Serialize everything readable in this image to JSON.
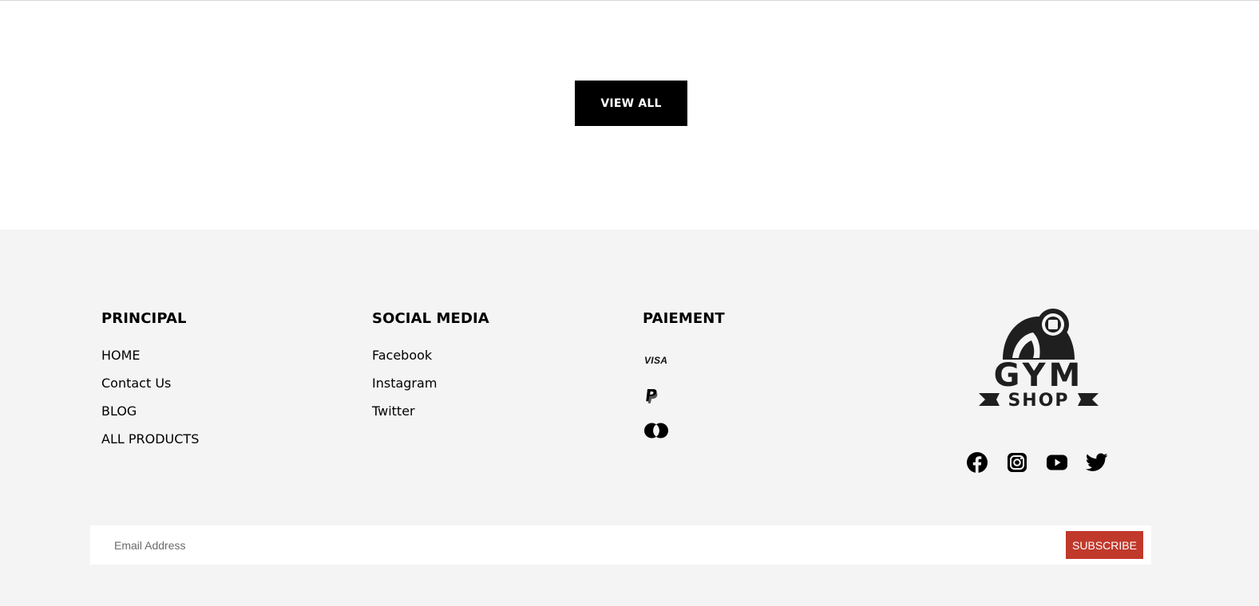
{
  "cta": {
    "view_all_label": "VIEW ALL"
  },
  "footer": {
    "columns": [
      {
        "heading": "PRINCIPAL",
        "links": [
          "HOME",
          "Contact Us",
          "BLOG",
          "ALL PRODUCTS"
        ]
      },
      {
        "heading": "SOCIAL MEDIA",
        "links": [
          "Facebook",
          "Instagram",
          "Twitter"
        ]
      },
      {
        "heading": "PAIEMENT",
        "methods": [
          {
            "icon": "visa-icon",
            "label": "VISA"
          },
          {
            "icon": "paypal-icon"
          },
          {
            "icon": "mastercard-icon"
          }
        ]
      }
    ],
    "logo": {
      "icon": "gym-shop-logo",
      "line1": "GYM",
      "line2": "SHOP"
    },
    "social_icons": [
      "facebook-icon",
      "instagram-icon",
      "youtube-icon",
      "twitter-icon"
    ],
    "newsletter": {
      "placeholder": "Email Address",
      "subscribe_label": "SUBSCRIBE"
    }
  },
  "colors": {
    "footer_bg": "#f4f4f4",
    "button_dark": "#000000",
    "subscribe_accent": "#c0392b"
  }
}
